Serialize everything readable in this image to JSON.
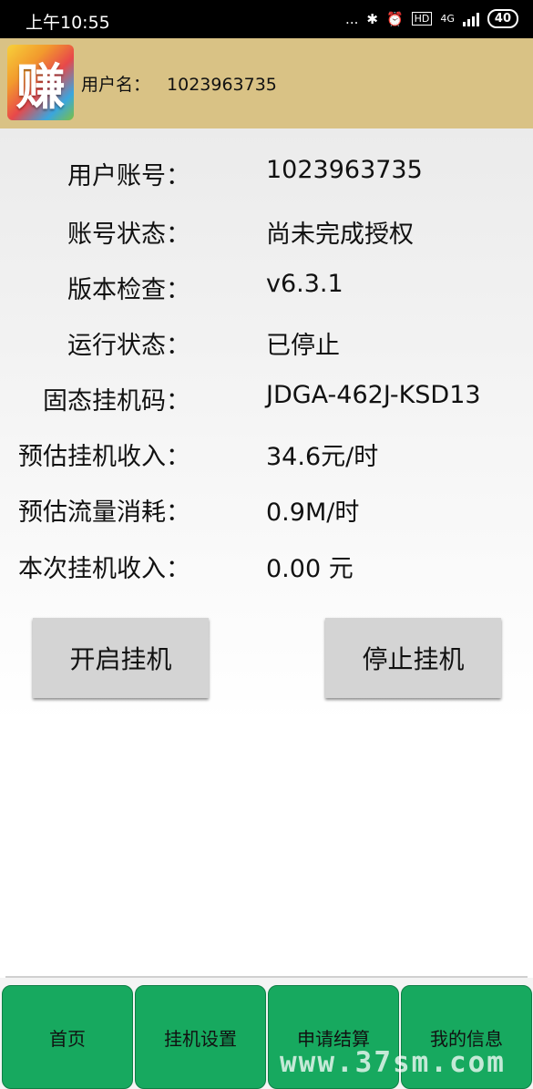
{
  "status_bar": {
    "time": "上午10:55",
    "dots": "...",
    "battery": "40",
    "network": "4G",
    "hd": "HD"
  },
  "header": {
    "logo_char": "赚",
    "username_label": "用户名：",
    "username_value": "1023963735"
  },
  "info": {
    "rows": [
      {
        "label": "用户账号：",
        "value": "1023963735"
      },
      {
        "label": "账号状态：",
        "value": "尚未完成授权"
      },
      {
        "label": "版本检查：",
        "value": "v6.3.1"
      },
      {
        "label": "运行状态：",
        "value": "已停止"
      },
      {
        "label": "固态挂机码：",
        "value": "JDGA-462J-KSD13"
      },
      {
        "label": "预估挂机收入：",
        "value": "34.6元/时"
      },
      {
        "label": "预估流量消耗：",
        "value": "0.9M/时"
      },
      {
        "label": "本次挂机收入：",
        "value": "0.00 元"
      }
    ]
  },
  "actions": {
    "start_label": "开启挂机",
    "stop_label": "停止挂机"
  },
  "nav": {
    "items": [
      {
        "label": "首页"
      },
      {
        "label": "挂机设置"
      },
      {
        "label": "申请结算"
      },
      {
        "label": "我的信息"
      }
    ]
  },
  "watermark": "www.37sm.com",
  "colors": {
    "header_bg": "#d9c285",
    "nav_green": "#17a95f",
    "button_gray": "#d4d4d4"
  }
}
